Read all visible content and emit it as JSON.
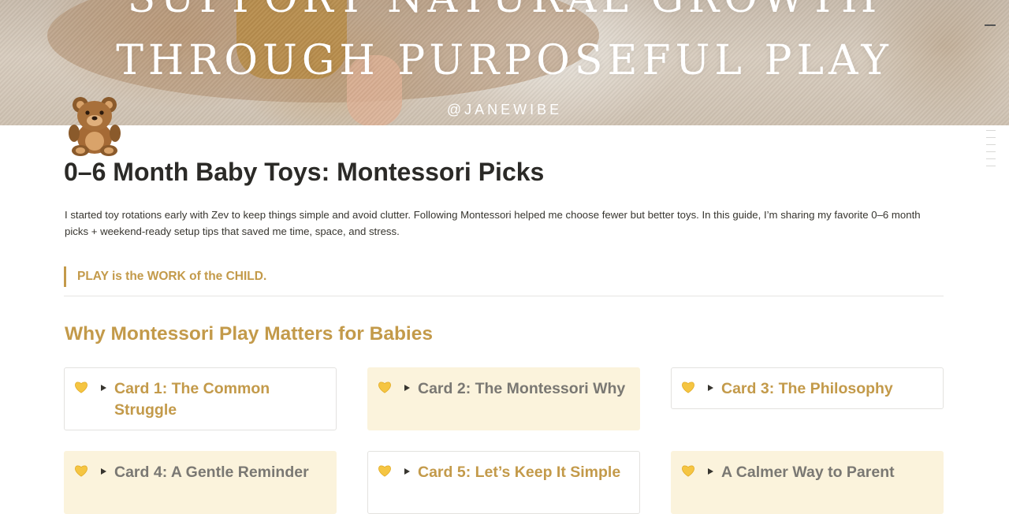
{
  "cover": {
    "title_line1": "SUPPORT NATURAL GROWTH",
    "title_line2": "THROUGH PURPOSEFUL PLAY",
    "handle": "@JANEWIBE"
  },
  "page": {
    "icon": "teddy-bear-icon",
    "title": "0–6 Month Baby Toys: Montessori Picks",
    "intro": "I started toy rotations early with Zev to keep things simple and avoid clutter. Following Montessori helped me choose fewer but better toys. In this guide, I’m sharing my favorite 0–6 month picks + weekend-ready setup tips that saved me time, space, and stress.",
    "quote": "PLAY is the WORK of the CHILD.",
    "section_heading": "Why Montessori Play Matters for Babies"
  },
  "cards": [
    {
      "label": "Card 1: The Common Struggle",
      "icon": "yellow-heart-icon"
    },
    {
      "label": "Card 2: The Montessori Why",
      "icon": "yellow-heart-icon"
    },
    {
      "label": "Card 3: The Philosophy",
      "icon": "yellow-heart-icon"
    },
    {
      "label": "Card 4: A Gentle Reminder",
      "icon": "yellow-heart-icon"
    },
    {
      "label": "Card 5: Let’s Keep It Simple",
      "icon": "yellow-heart-icon"
    },
    {
      "label": "A Calmer Way to Parent",
      "icon": "yellow-heart-icon"
    }
  ],
  "colors": {
    "accent_gold": "#c39a4a",
    "card_tint": "#fbf3dc",
    "text": "#37352f",
    "muted_text": "#7a7873"
  }
}
